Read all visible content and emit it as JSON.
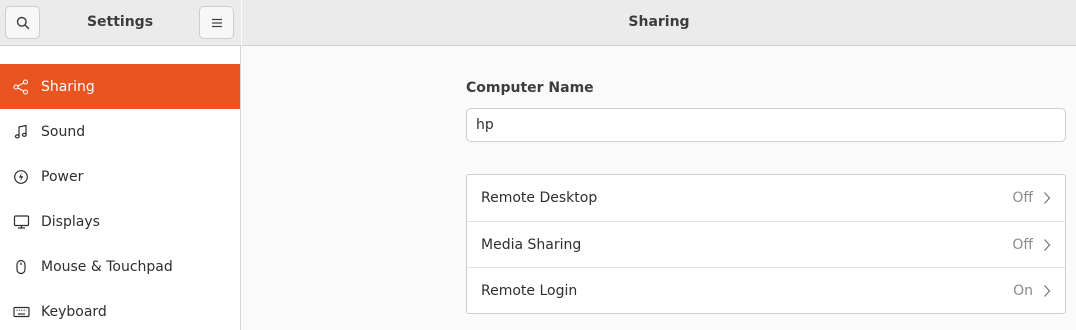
{
  "sidebar": {
    "title": "Settings",
    "items": [
      {
        "label": "Sharing",
        "icon": "share-icon",
        "active": true
      },
      {
        "label": "Sound",
        "icon": "music-note-icon"
      },
      {
        "label": "Power",
        "icon": "power-icon"
      },
      {
        "label": "Displays",
        "icon": "display-icon"
      },
      {
        "label": "Mouse & Touchpad",
        "icon": "mouse-icon"
      },
      {
        "label": "Keyboard",
        "icon": "keyboard-icon"
      }
    ]
  },
  "header": {
    "title": "Sharing"
  },
  "computer_name": {
    "label": "Computer Name",
    "value": "hp"
  },
  "services": [
    {
      "label": "Remote Desktop",
      "status": "Off"
    },
    {
      "label": "Media Sharing",
      "status": "Off"
    },
    {
      "label": "Remote Login",
      "status": "On"
    }
  ],
  "colors": {
    "accent": "#e95420",
    "header_bg": "#ebebeb"
  }
}
